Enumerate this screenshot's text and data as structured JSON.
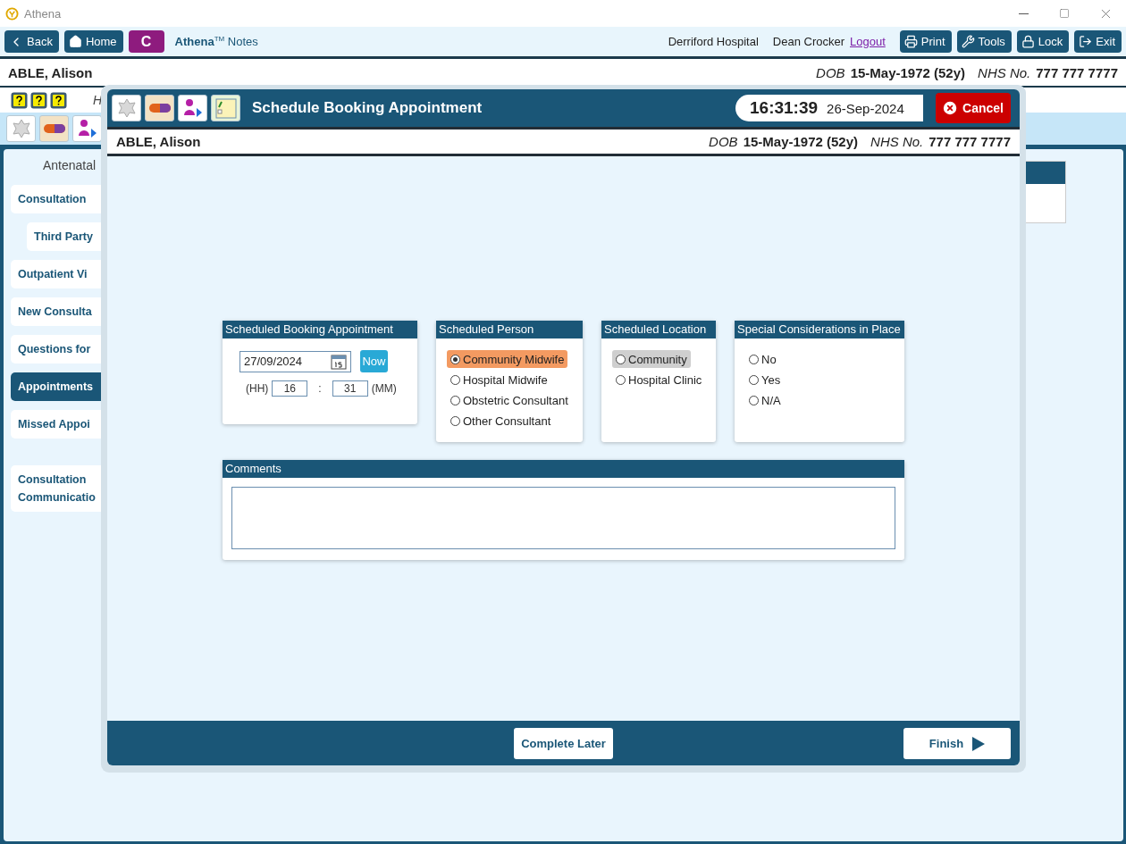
{
  "window": {
    "title": "Athena"
  },
  "toolbar": {
    "back": "Back",
    "home": "Home",
    "module": "C",
    "app_name": "Athena",
    "trademark": "TM",
    "app_suffix": "Notes",
    "hospital": "Derriford Hospital",
    "user": "Dean Crocker",
    "logout": "Logout",
    "buttons": [
      {
        "label": "Print",
        "kind": "print"
      },
      {
        "label": "Tools",
        "kind": "tools"
      },
      {
        "label": "Lock",
        "kind": "lock"
      },
      {
        "label": "Exit",
        "kind": "exit"
      }
    ]
  },
  "patient": {
    "name": "ABLE, Alison",
    "dob_label": "DOB",
    "dob": "15-May-1972 (52y)",
    "nhs_label": "NHS No.",
    "nhs": "777 777 7777"
  },
  "subheader": {
    "text": "H"
  },
  "sidebar": {
    "heading": "Antenatal",
    "items": [
      {
        "label": "Consultation",
        "selected": false,
        "children": [
          {
            "label": "Third Party",
            "selected": false
          }
        ]
      },
      {
        "label": "Outpatient Vi",
        "selected": false
      },
      {
        "label": "New Consulta",
        "selected": false
      },
      {
        "label": "Questions for",
        "selected": false
      },
      {
        "label": "Appointments",
        "selected": true
      },
      {
        "label": "Missed Appoi",
        "selected": false
      },
      {
        "label": "Consultation Communicatio",
        "selected": false
      }
    ]
  },
  "dialog": {
    "title": "Schedule Booking Appointment",
    "time": "16:31:39",
    "date": "26-Sep-2024",
    "cancel": "Cancel",
    "patient": {
      "name": "ABLE, Alison",
      "dob_label": "DOB",
      "dob": "15-May-1972 (52y)",
      "nhs_label": "NHS No.",
      "nhs": "777 777 7777"
    },
    "booking": {
      "title": "Scheduled Booking Appointment",
      "date": "27/09/2024",
      "now": "Now",
      "hh_label": "(HH)",
      "hh": "16",
      "separator": ":",
      "mm": "31",
      "mm_label": "(MM)"
    },
    "person": {
      "title": "Scheduled Person",
      "options": [
        {
          "label": "Community Midwife",
          "selected": true,
          "focused": false
        },
        {
          "label": "Hospital Midwife",
          "selected": false,
          "focused": false
        },
        {
          "label": "Obstetric Consultant",
          "selected": false,
          "focused": false
        },
        {
          "label": "Other Consultant",
          "selected": false,
          "focused": false
        }
      ]
    },
    "location": {
      "title": "Scheduled Location",
      "options": [
        {
          "label": "Community",
          "selected": false,
          "focused": true
        },
        {
          "label": "Hospital Clinic",
          "selected": false,
          "focused": false
        }
      ]
    },
    "special": {
      "title": "Special Considerations in Place",
      "options": [
        {
          "label": "No",
          "selected": false,
          "focused": false
        },
        {
          "label": "Yes",
          "selected": false,
          "focused": false
        },
        {
          "label": "N/A",
          "selected": false,
          "focused": false
        }
      ]
    },
    "comments": {
      "title": "Comments"
    },
    "complete_later": "Complete Later",
    "finish": "Finish"
  }
}
